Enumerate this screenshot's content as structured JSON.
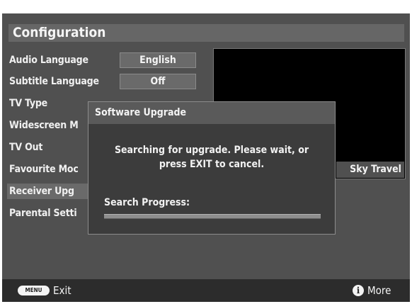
{
  "header": {
    "title": "Configuration"
  },
  "menu": {
    "items": [
      {
        "label": "Audio Language"
      },
      {
        "label": "Subtitle Language"
      },
      {
        "label": "TV Type"
      },
      {
        "label": "Widescreen M"
      },
      {
        "label": "TV Out"
      },
      {
        "label": "Favourite Moc"
      },
      {
        "label": "Receiver Upg"
      },
      {
        "label": "Parental Setti"
      }
    ],
    "values": [
      {
        "value": "English"
      },
      {
        "value": "Off"
      }
    ]
  },
  "preview": {
    "channel": "Sky Travel"
  },
  "dialog": {
    "title": "Software Upgrade",
    "message_line1": "Searching for upgrade. Please wait, or",
    "message_line2": "press EXIT to cancel.",
    "progress_label": "Search Progress:",
    "progress": 0
  },
  "footer": {
    "menu_key": "MENU",
    "exit_label": "Exit",
    "more_label": "More"
  }
}
